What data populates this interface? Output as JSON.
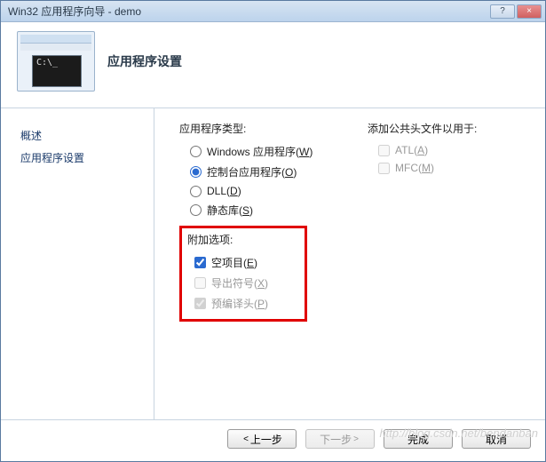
{
  "window": {
    "title": "Win32 应用程序向导 - demo",
    "help_label": "?",
    "close_label": "×"
  },
  "header": {
    "title": "应用程序设置",
    "console_prompt": "C:\\_"
  },
  "sidebar": {
    "items": [
      {
        "label": "概述"
      },
      {
        "label": "应用程序设置"
      }
    ]
  },
  "main": {
    "app_type": {
      "label": "应用程序类型:",
      "options": [
        {
          "label": "Windows 应用程序",
          "mnemonic": "W",
          "checked": false
        },
        {
          "label": "控制台应用程序",
          "mnemonic": "O",
          "checked": true
        },
        {
          "label": "DLL",
          "mnemonic": "D",
          "checked": false
        },
        {
          "label": "静态库",
          "mnemonic": "S",
          "checked": false
        }
      ]
    },
    "additional": {
      "label": "附加选项:",
      "options": [
        {
          "label": "空项目",
          "mnemonic": "E",
          "checked": true,
          "disabled": false
        },
        {
          "label": "导出符号",
          "mnemonic": "X",
          "checked": false,
          "disabled": true
        },
        {
          "label": "预编译头",
          "mnemonic": "P",
          "checked": true,
          "disabled": true
        }
      ]
    },
    "headers": {
      "label": "添加公共头文件以用于:",
      "options": [
        {
          "label": "ATL",
          "mnemonic": "A",
          "checked": false,
          "disabled": true
        },
        {
          "label": "MFC",
          "mnemonic": "M",
          "checked": false,
          "disabled": true
        }
      ]
    }
  },
  "footer": {
    "prev": "上一步",
    "next": "下一步",
    "finish": "完成",
    "cancel": "取消"
  },
  "watermark": "http://blog.csdn.net/bendanban"
}
